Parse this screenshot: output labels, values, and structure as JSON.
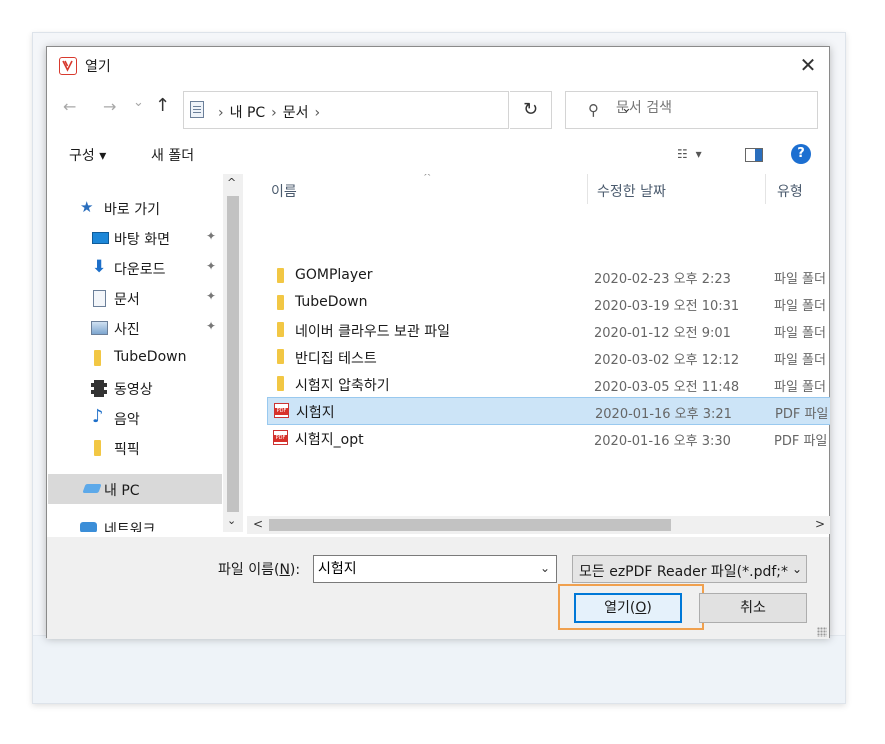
{
  "dialog": {
    "title": "열기",
    "close_symbol": "✕"
  },
  "nav": {
    "back_symbol": "←",
    "forward_symbol": "→",
    "recent_symbol": "⌄",
    "up_symbol": "↑",
    "breadcrumb": [
      "내 PC",
      "문서"
    ],
    "crumb_sep": "›",
    "dropdown_symbol": "⌄",
    "refresh_symbol": "↻",
    "search_icon_symbol": "⚲",
    "search_placeholder": "문서 검색"
  },
  "toolbar": {
    "organize_label": "구성 ▾",
    "new_folder_label": "새 폴더",
    "view_symbol": "☷ ▾",
    "help_symbol": "?"
  },
  "sidebar": {
    "items": [
      {
        "label": "바로 가기",
        "icon": "star-icon",
        "pinned": false
      },
      {
        "label": "바탕 화면",
        "icon": "desktop-icon",
        "pinned": true
      },
      {
        "label": "다운로드",
        "icon": "download-icon",
        "pinned": true
      },
      {
        "label": "문서",
        "icon": "document-icon",
        "pinned": true
      },
      {
        "label": "사진",
        "icon": "pictures-icon",
        "pinned": true
      },
      {
        "label": "TubeDown",
        "icon": "folder-icon",
        "pinned": false
      },
      {
        "label": "동영상",
        "icon": "video-icon",
        "pinned": false
      },
      {
        "label": "음악",
        "icon": "music-icon",
        "pinned": false
      },
      {
        "label": "픽픽",
        "icon": "folder-icon",
        "pinned": false
      },
      {
        "label": "내 PC",
        "icon": "computer-icon",
        "pinned": false,
        "selected": true
      },
      {
        "label": "네트워크",
        "icon": "network-icon",
        "pinned": false
      }
    ],
    "pin_symbol": "📌"
  },
  "filelist": {
    "columns": [
      "이름",
      "수정한 날짜",
      "유형"
    ],
    "sort_caret": "^",
    "rows": [
      {
        "name": "GOMPlayer",
        "date": "2020-02-23 오후 2:23",
        "type": "파일 폴더",
        "icon": "folder-icon"
      },
      {
        "name": "TubeDown",
        "date": "2020-03-19 오전 10:31",
        "type": "파일 폴더",
        "icon": "folder-icon"
      },
      {
        "name": "네이버 클라우드 보관 파일",
        "date": "2020-01-12 오전 9:01",
        "type": "파일 폴더",
        "icon": "folder-icon"
      },
      {
        "name": "반디집 테스트",
        "date": "2020-03-02 오후 12:12",
        "type": "파일 폴더",
        "icon": "folder-icon"
      },
      {
        "name": "시험지 압축하기",
        "date": "2020-03-05 오전 11:48",
        "type": "파일 폴더",
        "icon": "folder-icon"
      },
      {
        "name": "시험지",
        "date": "2020-01-16 오후 3:21",
        "type": "PDF 파일",
        "icon": "pdf-icon",
        "selected": true
      },
      {
        "name": "시험지_opt",
        "date": "2020-01-16 오후 3:30",
        "type": "PDF 파일",
        "icon": "pdf-icon"
      }
    ]
  },
  "scroll": {
    "up_symbol": "^",
    "down_symbol": "⌄",
    "left_symbol": "<",
    "right_symbol": ">"
  },
  "bottom": {
    "filename_label_pre": "파일 이름(",
    "filename_label_key": "N",
    "filename_label_post": "):",
    "filename_value": "시험지",
    "dropdown_symbol": "⌄",
    "filter_value": "모든 ezPDF Reader 파일(*.pdf;*",
    "open_label_pre": "열기(",
    "open_label_key": "O",
    "open_label_post": ")",
    "cancel_label": "취소"
  },
  "colors": {
    "accent": "#0078d7",
    "highlight": "#f0a04e",
    "selection": "#cce4f7",
    "folder": "#f2c744",
    "pdf": "#d8312a"
  }
}
